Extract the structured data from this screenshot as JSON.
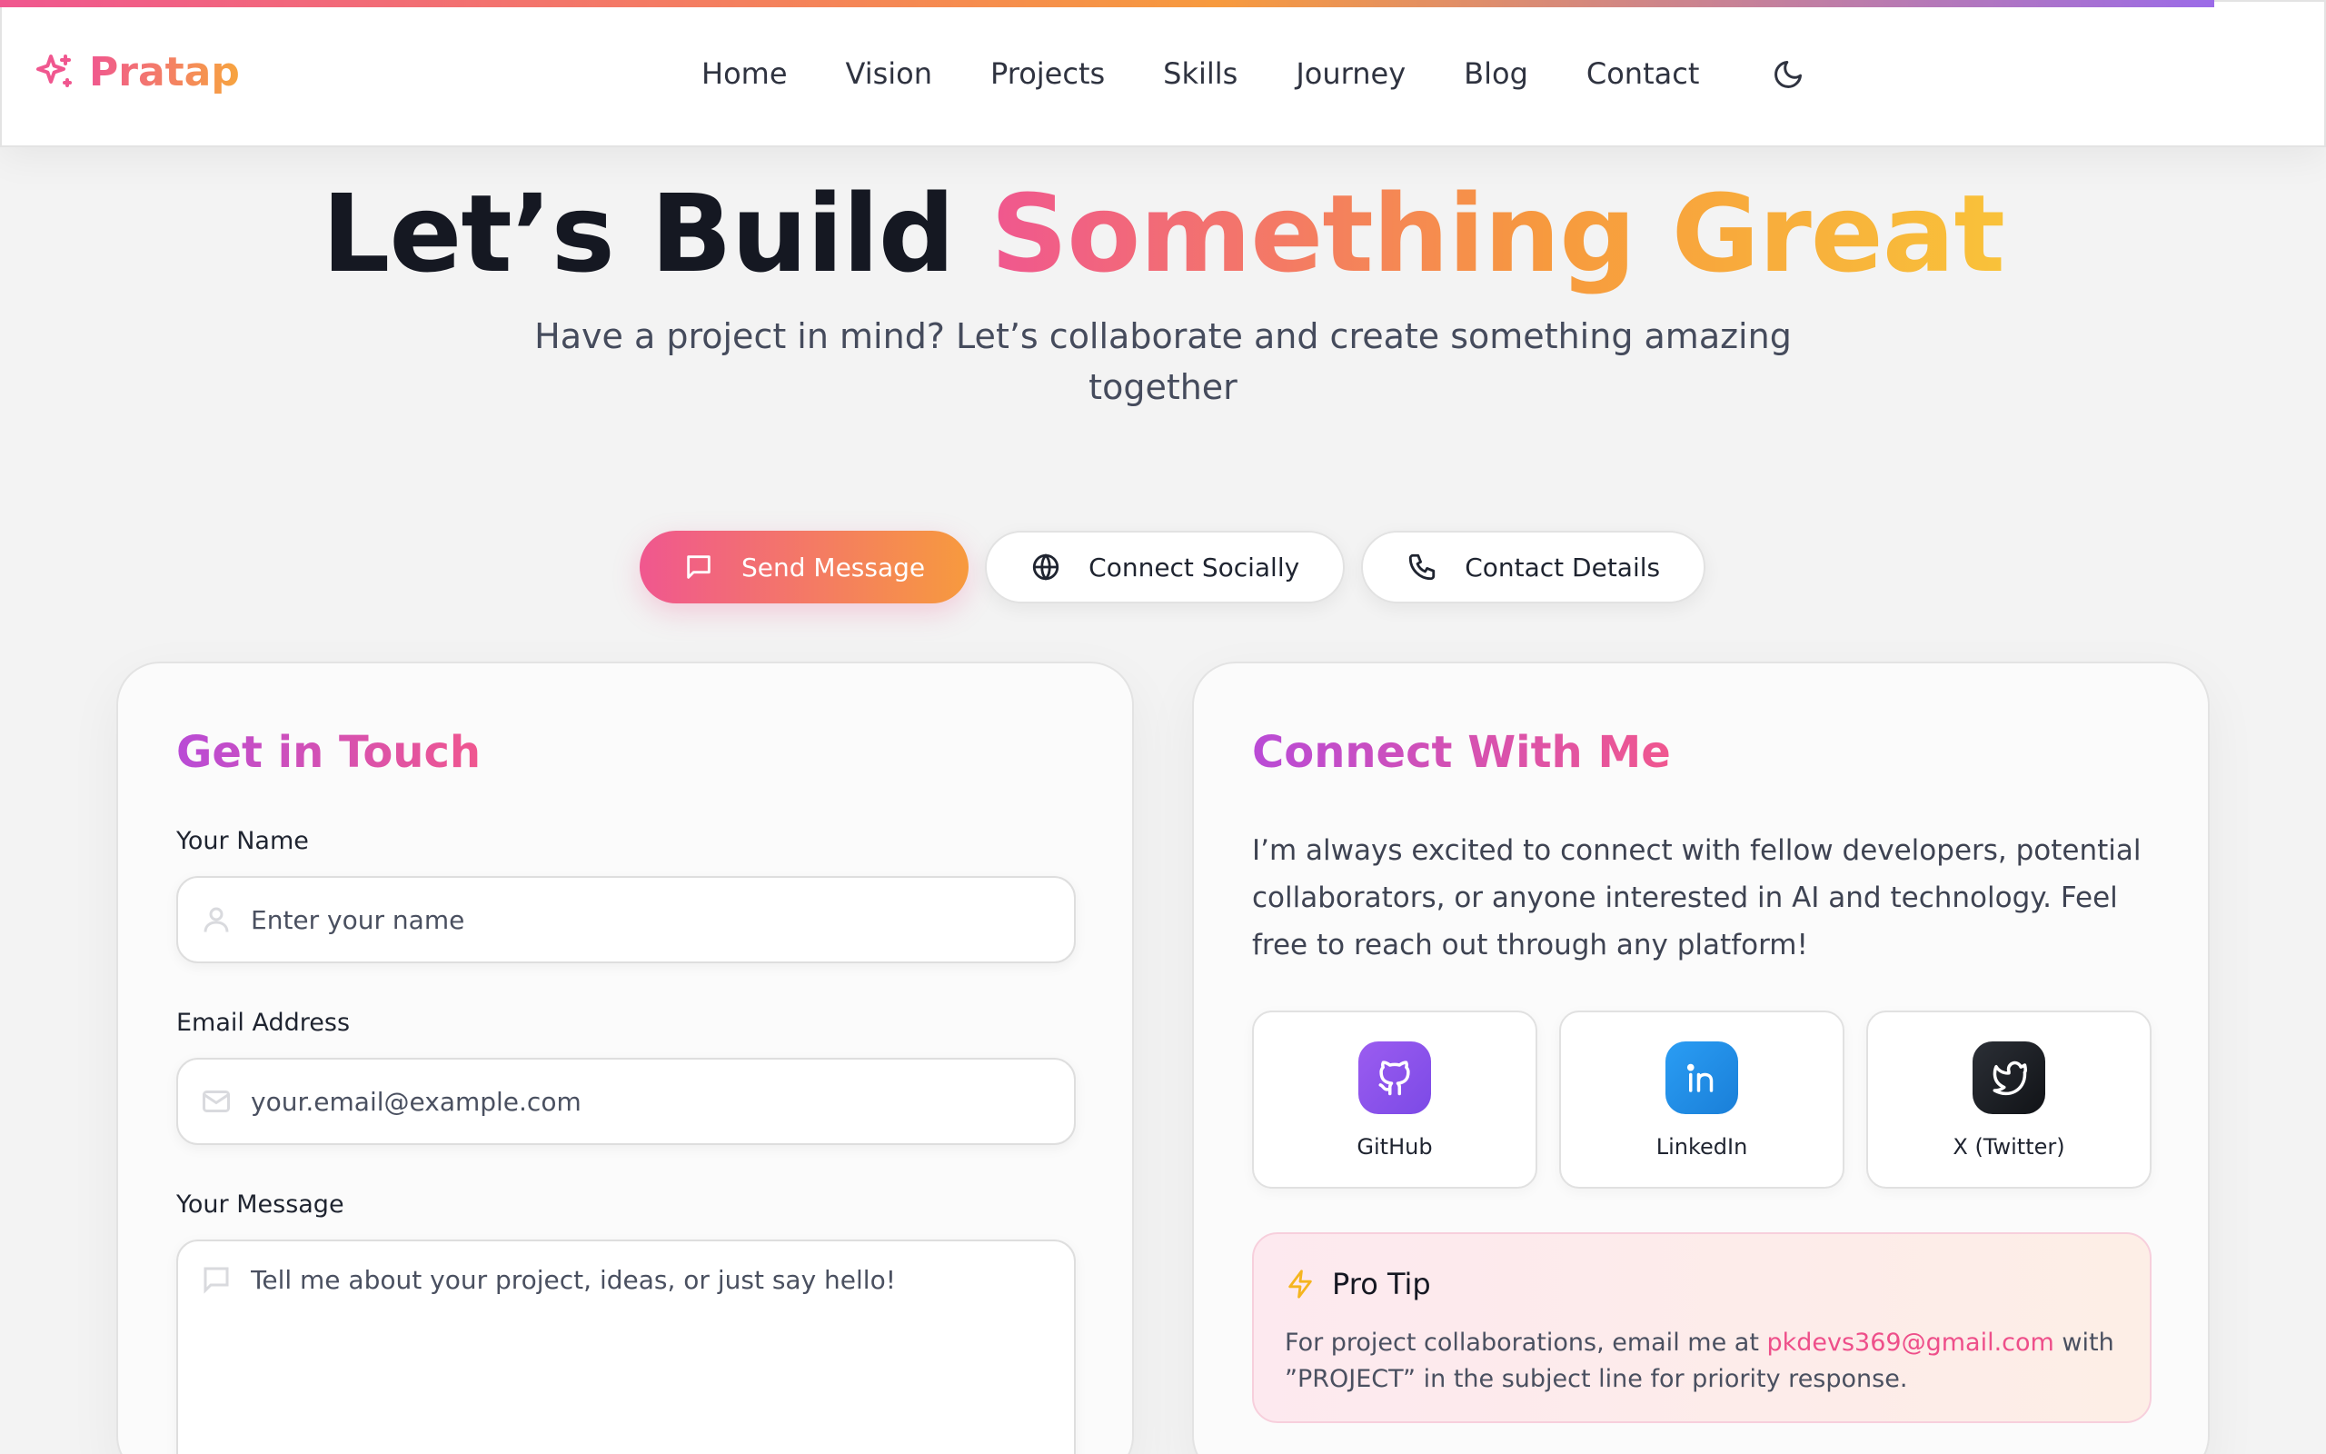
{
  "brand": {
    "name": "Pratap"
  },
  "nav": {
    "items": [
      "Home",
      "Vision",
      "Projects",
      "Skills",
      "Journey",
      "Blog",
      "Contact"
    ]
  },
  "hero": {
    "title_plain": "Let’s Build",
    "title_gradient": "Something Great",
    "subtitle": "Have a project in mind? Let’s collaborate and create something amazing together"
  },
  "tabs": [
    {
      "label": "Send Message",
      "icon": "message-icon",
      "active": true
    },
    {
      "label": "Connect Socially",
      "icon": "globe-icon",
      "active": false
    },
    {
      "label": "Contact Details",
      "icon": "phone-icon",
      "active": false
    }
  ],
  "form": {
    "title": "Get in Touch",
    "name_label": "Your Name",
    "name_placeholder": "Enter your name",
    "email_label": "Email Address",
    "email_placeholder": "your.email@example.com",
    "message_label": "Your Message",
    "message_placeholder": "Tell me about your project, ideas, or just say hello!"
  },
  "connect": {
    "title": "Connect With Me",
    "intro": "I’m always excited to connect with fellow developers, potential collaborators, or anyone interested in AI and technology. Feel free to reach out through any platform!",
    "socials": [
      {
        "label": "GitHub",
        "icon": "github-icon"
      },
      {
        "label": "LinkedIn",
        "icon": "linkedin-icon"
      },
      {
        "label": "X (Twitter)",
        "icon": "twitter-icon"
      }
    ],
    "tip": {
      "title": "Pro Tip",
      "body_before": "For project collaborations, email me at ",
      "email": "pkdevs369@gmail.com",
      "body_after": " with ”PROJECT” in the subject line for priority response."
    }
  },
  "colors": {
    "accent_pink": "#f0578f",
    "accent_orange": "#f79a3e",
    "accent_purple": "#b94bd6",
    "background": "#f3f3f3"
  }
}
